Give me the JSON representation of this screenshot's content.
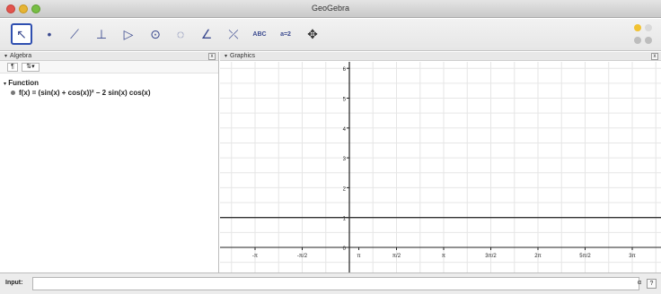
{
  "window": {
    "title": "GeoGebra"
  },
  "toolbar": {
    "tools": [
      {
        "name": "move-tool-icon",
        "glyph": "↖",
        "selected": true
      },
      {
        "name": "point-tool-icon",
        "glyph": "•"
      },
      {
        "name": "line-tool-icon",
        "glyph": "⟋"
      },
      {
        "name": "perpendicular-tool-icon",
        "glyph": "⊥"
      },
      {
        "name": "polygon-tool-icon",
        "glyph": "▷"
      },
      {
        "name": "circle-tool-icon",
        "glyph": "⊙"
      },
      {
        "name": "conic-tool-icon",
        "glyph": "◌"
      },
      {
        "name": "angle-tool-icon",
        "glyph": "∠"
      },
      {
        "name": "reflect-tool-icon",
        "glyph": "⤫"
      },
      {
        "name": "text-tool-icon",
        "glyph": "ABC"
      },
      {
        "name": "slider-tool-icon",
        "glyph": "a=2"
      },
      {
        "name": "move-view-tool-icon",
        "glyph": "✥"
      }
    ]
  },
  "algebra": {
    "header": "Algebra",
    "close": "x",
    "category": "Function",
    "item": "f(x) = (sin(x) + cos(x))² − 2 sin(x) cos(x)"
  },
  "graphics": {
    "header": "Graphics",
    "close": "x",
    "x_ticks": [
      "-π",
      "-π/2",
      "π",
      "π/2",
      "π",
      "3π/2",
      "2π",
      "5π/2",
      "3π"
    ],
    "y_ticks": [
      "6",
      "5",
      "4",
      "3",
      "2",
      "1",
      "0"
    ]
  },
  "input": {
    "label": "Input:",
    "alpha": "α",
    "help": "?"
  }
}
